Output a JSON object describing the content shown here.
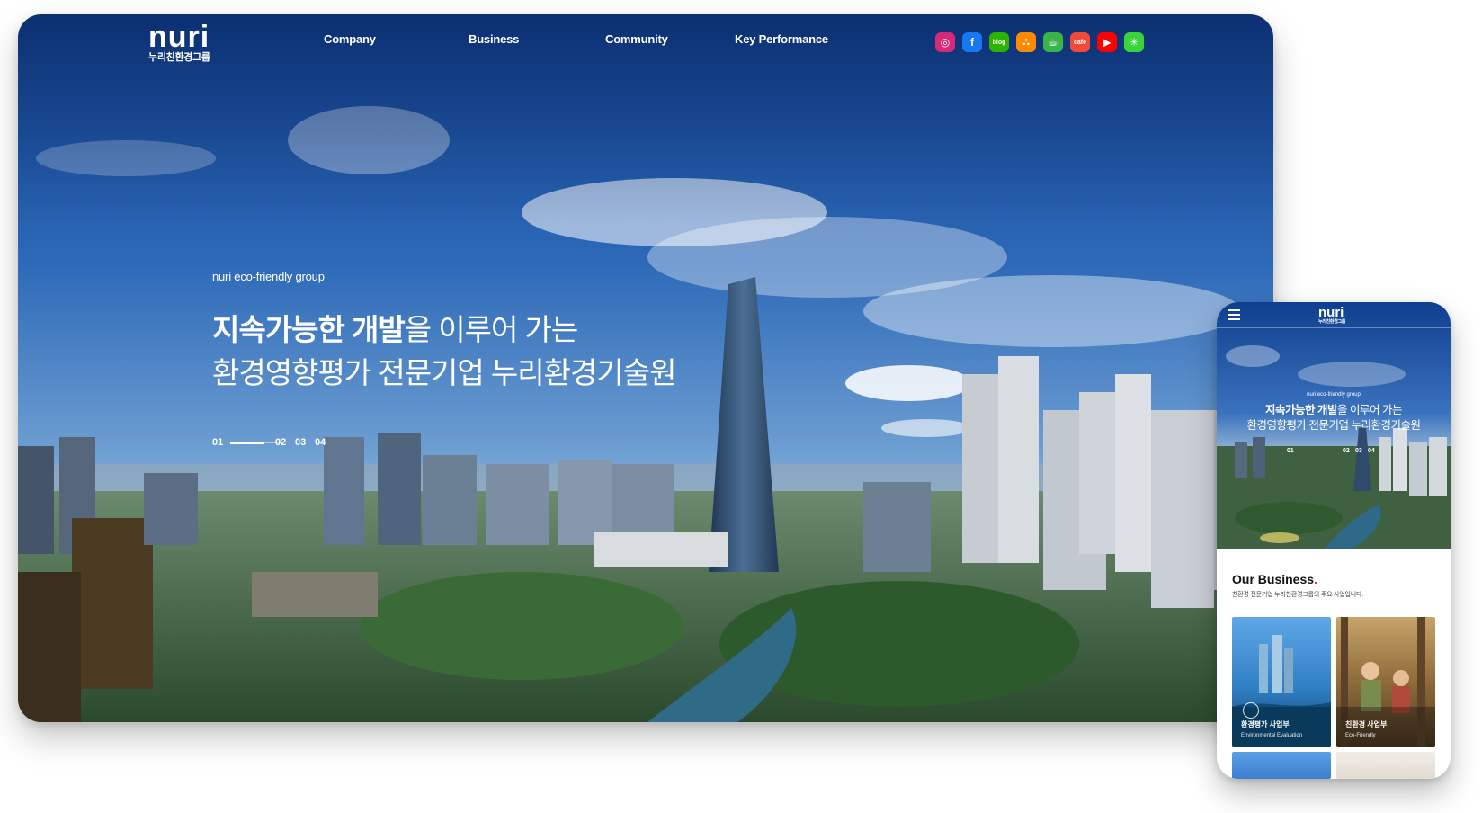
{
  "desktop": {
    "logo": {
      "word": "nuri",
      "sub": "누리친환경그룹"
    },
    "nav": [
      "Company",
      "Business",
      "Community",
      "Key Performance"
    ],
    "social_icons": [
      {
        "name": "instagram-icon",
        "color": "#d62976",
        "glyph": "◎"
      },
      {
        "name": "facebook-icon",
        "color": "#1877f2",
        "glyph": "f"
      },
      {
        "name": "naver-blog-icon",
        "color": "#2db400",
        "glyph": "blog"
      },
      {
        "name": "naver-post-icon",
        "color": "#ff8a00",
        "glyph": "∴"
      },
      {
        "name": "naver-cafe-icon",
        "color": "#3ab44a",
        "glyph": "☕"
      },
      {
        "name": "daum-cafe-icon",
        "color": "#f04a3a",
        "glyph": "cafe"
      },
      {
        "name": "youtube-icon",
        "color": "#ff0000",
        "glyph": "▶"
      },
      {
        "name": "asterisk-icon",
        "color": "#3ad43a",
        "glyph": "✳"
      }
    ],
    "hero": {
      "tagline": "nuri eco-friendly group",
      "line1_bold": "지속가능한 개발",
      "line1_rest": "을 이루어 가는",
      "line2": "환경영향평가 전문기업 누리환경기술원"
    },
    "pager": {
      "current": "01",
      "others": [
        "02",
        "03",
        "04"
      ]
    }
  },
  "mobile": {
    "logo": {
      "word": "nuri",
      "sub": "누리친환경그룹"
    },
    "hero": {
      "tagline": "nuri eco-friendly group",
      "line1_bold": "지속가능한 개발",
      "line1_rest": "을 이루어 가는",
      "line2": "환경영향평가 전문기업 누리환경기술원"
    },
    "pager": {
      "current": "01",
      "others": [
        "02",
        "03",
        "04"
      ]
    },
    "business": {
      "title": "Our Business",
      "subtitle": "친환경 전문기업 누리친환경그룹의 주요 사업입니다.",
      "cards": [
        {
          "title": "환경평가 사업부",
          "subtitle": "Environmental Evaluation"
        },
        {
          "title": "친환경 사업부",
          "subtitle": "Eco-Friendly"
        }
      ]
    }
  }
}
